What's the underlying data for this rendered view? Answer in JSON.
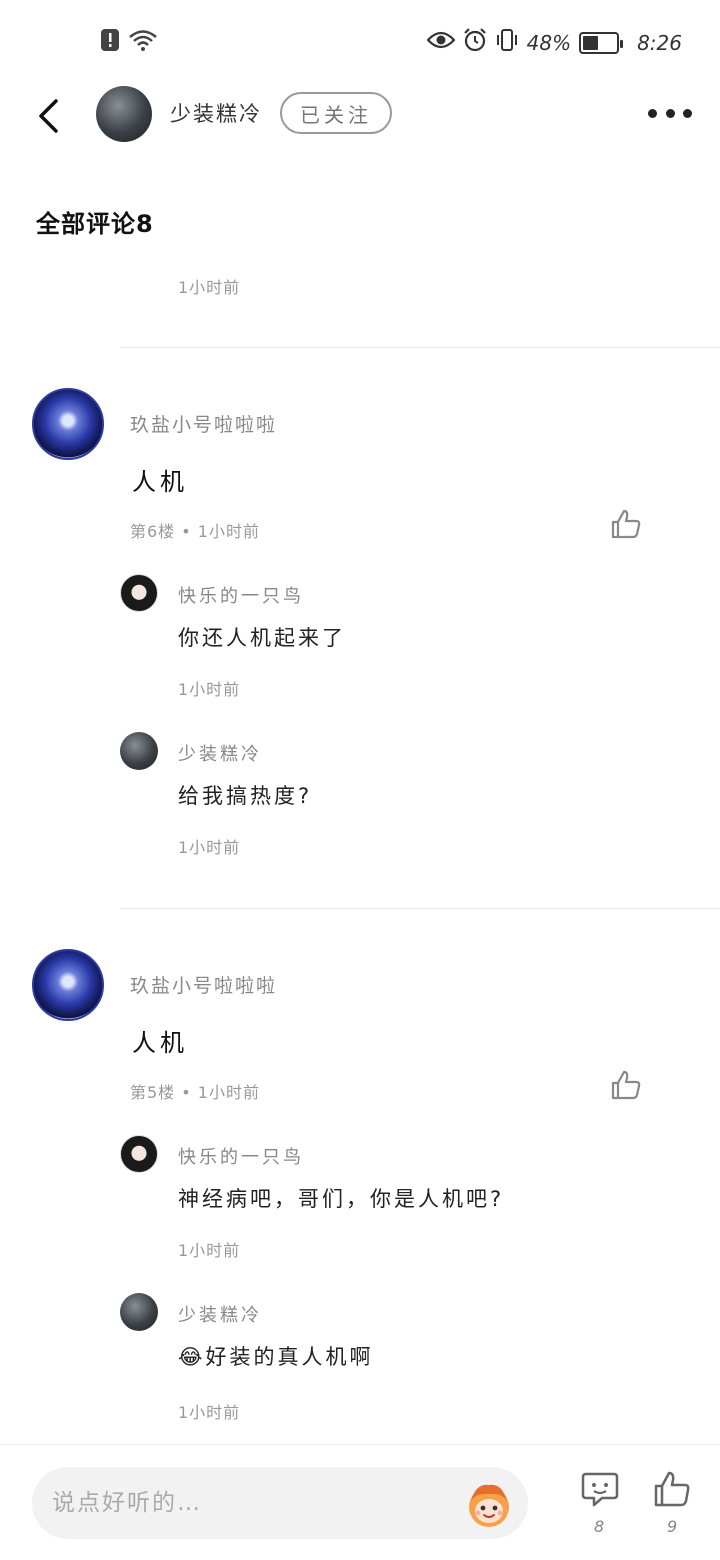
{
  "status_bar": {
    "battery_percent": "48%",
    "time": "8:26",
    "battery_level": 0.48
  },
  "header": {
    "author_name": "少装糕冷",
    "follow_label": "已关注"
  },
  "comments_section": {
    "title": "全部评论8",
    "top_partial_time": "1小时前"
  },
  "comments": [
    {
      "author": "玖盐小号啦啦啦",
      "text": "人机",
      "meta": "第6楼 • 1小时前",
      "replies": [
        {
          "author": "快乐的一只鸟",
          "text": "你还人机起来了",
          "time": "1小时前",
          "avatar": "girl"
        },
        {
          "author": "少装糕冷",
          "text": "给我搞热度?",
          "time": "1小时前",
          "avatar": "dark"
        }
      ]
    },
    {
      "author": "玖盐小号啦啦啦",
      "text": "人机",
      "meta": "第5楼 • 1小时前",
      "replies": [
        {
          "author": "快乐的一只鸟",
          "text": "神经病吧，哥们，你是人机吧?",
          "time": "1小时前",
          "avatar": "girl"
        },
        {
          "author": "少装糕冷",
          "text": "😂好装的真人机啊",
          "time": "1小时前",
          "avatar": "dark"
        }
      ]
    }
  ],
  "bottom_bar": {
    "input_placeholder": "说点好听的…",
    "comment_count": "8",
    "like_count": "9"
  },
  "icons": {
    "back": "chevron-left-icon",
    "more": "more-dots-icon",
    "like": "thumbs-up-icon",
    "comment": "comment-bubble-icon",
    "emoji": "emoji-sticker-icon"
  }
}
